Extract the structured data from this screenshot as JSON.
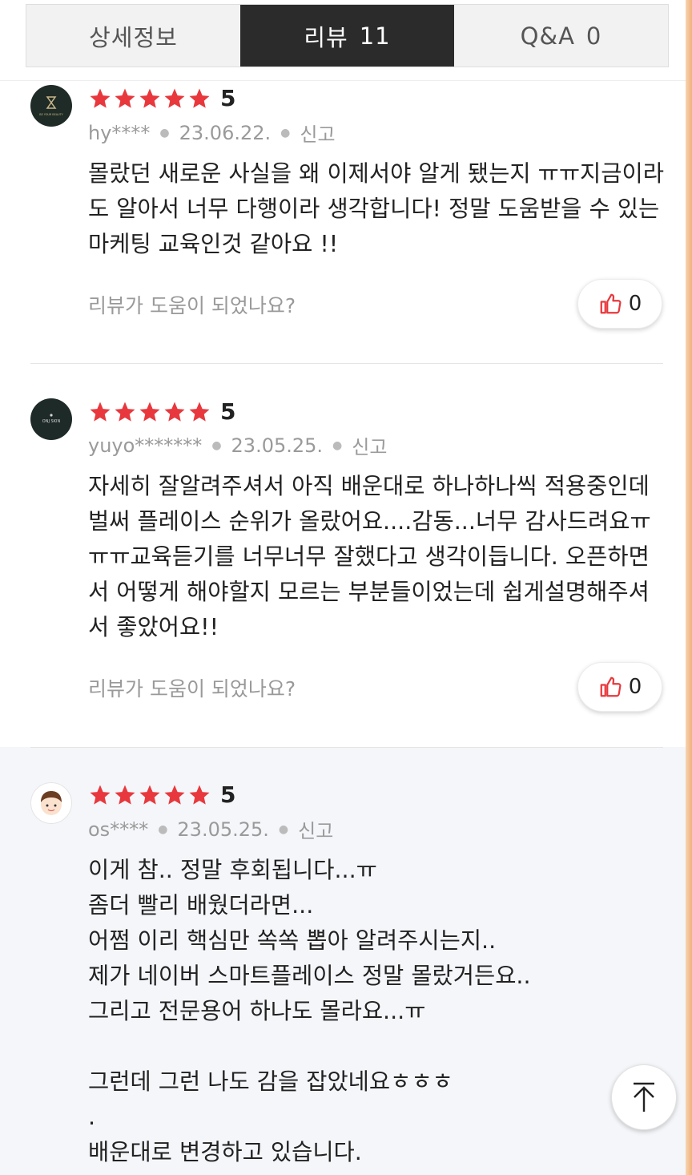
{
  "tabs": [
    {
      "label": "상세정보",
      "count": ""
    },
    {
      "label": "리뷰",
      "count": "11"
    },
    {
      "label": "Q&A",
      "count": "0"
    }
  ],
  "helpful_prompt": "리뷰가 도움이 되었나요?",
  "report_label": "신고",
  "reviews": [
    {
      "rating": "5",
      "stars": 5,
      "user": "hy****",
      "date": "23.06.22.",
      "text": "몰랐던 새로운 사실을 왜 이제서야 알게 됐는지 ㅠㅠ지금이라도 알아서 너무 다행이라 생각합니다! 정말 도움받을 수 있는 마케팅 교육인것 같아요 !!",
      "likes": "0",
      "avatar_text": "BE YOUR BEAUTY"
    },
    {
      "rating": "5",
      "stars": 5,
      "user": "yuyo*******",
      "date": "23.05.25.",
      "text": "자세히 잘알려주셔서 아직 배운대로 하나하나씩 적용중인데 벌써 플레이스 순위가 올랐어요....감동...너무 감사드려요ㅠㅠㅠ교육듣기를 너무너무 잘했다고 생각이듭니다. 오픈하면서 어떻게 해야할지 모르는 부분들이었는데 쉽게설명해주셔서 좋았어요!!",
      "likes": "0",
      "avatar_text": "ONJ SKIN"
    },
    {
      "rating": "5",
      "stars": 5,
      "user": "os****",
      "date": "23.05.25.",
      "text": "이게 참.. 정말 후회됩니다...ㅠ\n좀더 빨리 배웠더라면...\n어쩜 이리 핵심만 쏙쏙 뽑아 알려주시는지..\n제가 네이버 스마트플레이스 정말 몰랐거든요..\n그리고 전문용어 하나도 몰라요...ㅠ\n\n그런데 그런 나도 감을 잡았네요ㅎㅎㅎ\n.\n배운대로 변경하고 있습니다.",
      "likes": "",
      "avatar_text": ""
    }
  ],
  "colors": {
    "star": "#e8383d",
    "active_tab_bg": "#2b2b2b",
    "highlight_bg": "#f4f6f9",
    "thumb": "#e8383d"
  }
}
